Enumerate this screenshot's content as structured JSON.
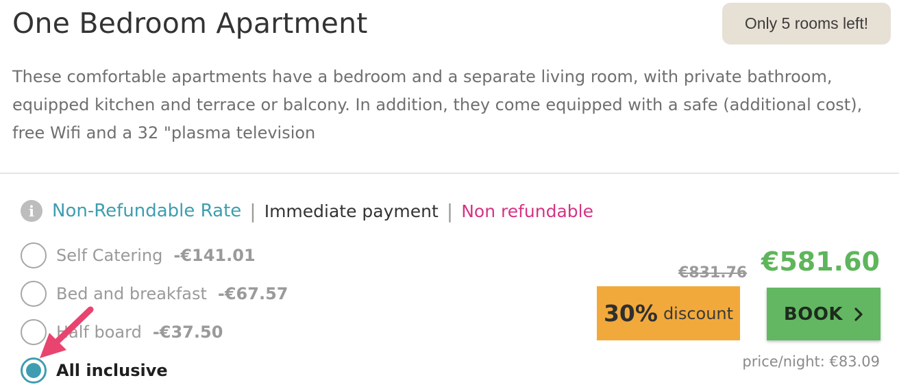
{
  "room": {
    "title": "One Bedroom Apartment",
    "availability_badge": "Only 5 rooms left!",
    "description": "These comfortable apartments have a bedroom and a separate living room, with private bathroom, equipped kitchen and terrace or balcony. In addition, they come equipped with a safe (additional cost), free Wifi and a 32 \"plasma television"
  },
  "rate": {
    "info_icon": "info-icon",
    "name": "Non-Refundable Rate",
    "separator": "|",
    "payment": "Immediate payment",
    "refund_policy": "Non refundable",
    "colors": {
      "rate_name": "#3e9db0",
      "refund_policy": "#d63384"
    }
  },
  "board_options": [
    {
      "label": "Self Catering",
      "price_diff": "-€141.01",
      "selected": false
    },
    {
      "label": "Bed and breakfast",
      "price_diff": "-€67.57",
      "selected": false
    },
    {
      "label": "Half board",
      "price_diff": "-€37.50",
      "selected": false
    },
    {
      "label": "All inclusive",
      "price_diff": "",
      "selected": true
    }
  ],
  "pricing": {
    "old_price": "€831.76",
    "discount_percent": "30%",
    "discount_word": "discount",
    "new_price": "€581.60",
    "book_label": "BOOK",
    "book_icon": "chevron-right-icon",
    "price_per_night": "price/night: €83.09",
    "colors": {
      "discount_bg": "#f2a93b",
      "book_bg": "#63b762",
      "new_price": "#5fb55b"
    }
  },
  "annotation": {
    "arrow_icon": "pointer-arrow-icon",
    "color": "#e8446f"
  }
}
